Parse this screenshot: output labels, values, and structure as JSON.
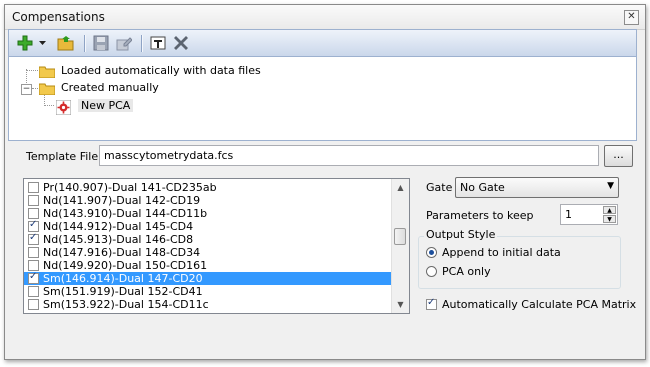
{
  "window": {
    "title": "Compensations"
  },
  "toolbar": {
    "icons": [
      "add-icon",
      "dropdown-arrow-icon",
      "open-folder-icon",
      "save-icon",
      "edit-icon",
      "rename-icon",
      "delete-icon"
    ]
  },
  "tree": {
    "items": [
      {
        "label": "Loaded automatically with data files",
        "level": 0
      },
      {
        "label": "Created manually",
        "level": 0,
        "expanded": true
      },
      {
        "label": "New PCA",
        "level": 1,
        "selected": true
      }
    ]
  },
  "template": {
    "label": "Template File:",
    "value": "masscytometrydata.fcs",
    "browse_label": "..."
  },
  "parameters": {
    "items": [
      {
        "label": "Pr(140.907)-Dual 141-CD235ab",
        "checked": false,
        "selected": false
      },
      {
        "label": "Nd(141.907)-Dual 142-CD19",
        "checked": false,
        "selected": false
      },
      {
        "label": "Nd(143.910)-Dual 144-CD11b",
        "checked": false,
        "selected": false
      },
      {
        "label": "Nd(144.912)-Dual 145-CD4",
        "checked": true,
        "selected": false
      },
      {
        "label": "Nd(145.913)-Dual 146-CD8",
        "checked": true,
        "selected": false
      },
      {
        "label": "Nd(147.916)-Dual 148-CD34",
        "checked": false,
        "selected": false
      },
      {
        "label": "Nd(149.920)-Dual 150-CD161",
        "checked": false,
        "selected": false
      },
      {
        "label": "Sm(146.914)-Dual 147-CD20",
        "checked": true,
        "selected": true
      },
      {
        "label": "Sm(151.919)-Dual 152-CD41",
        "checked": false,
        "selected": false
      },
      {
        "label": "Sm(153.922)-Dual 154-CD11c",
        "checked": false,
        "selected": false
      }
    ]
  },
  "gate": {
    "label": "Gate",
    "value": "No Gate"
  },
  "params_to_keep": {
    "label": "Parameters to keep",
    "value": "1"
  },
  "output_style": {
    "legend": "Output Style",
    "options": [
      {
        "label": "Append to initial data",
        "selected": true
      },
      {
        "label": "PCA only",
        "selected": false
      }
    ]
  },
  "auto_calc": {
    "label": "Automatically Calculate PCA Matrix",
    "checked": true
  },
  "colors": {
    "selection": "#3399ff",
    "toolbar_top": "#eef3fa",
    "toolbar_bottom": "#c9d6ea"
  }
}
